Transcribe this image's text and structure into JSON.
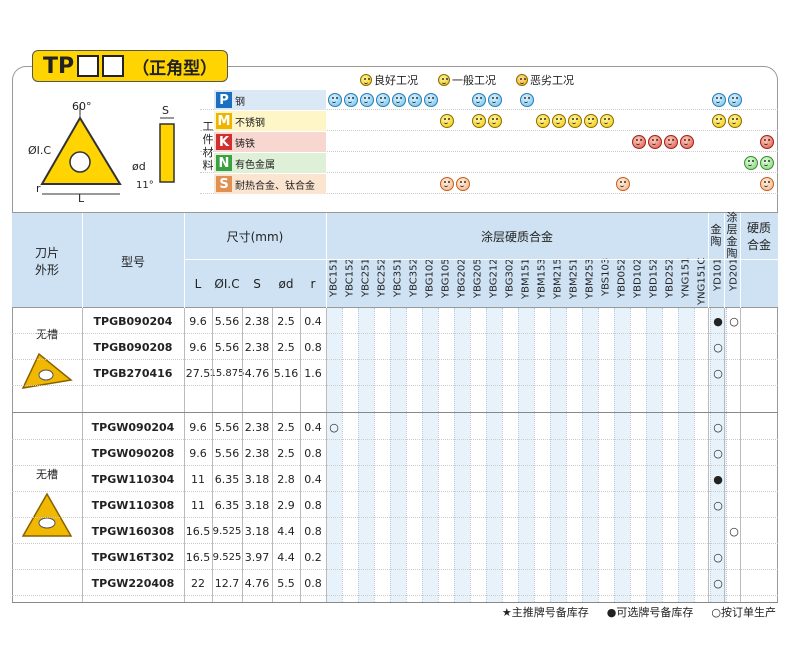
{
  "title": {
    "main": "TP",
    "sub": "（正角型）"
  },
  "legend_top": [
    {
      "icon": "good-face-icon",
      "label": "良好工况"
    },
    {
      "icon": "normal-face-icon",
      "label": "一般工况"
    },
    {
      "icon": "bad-face-icon",
      "label": "恶劣工况"
    }
  ],
  "diagram": {
    "angle": "60°",
    "ic": "ØI.C",
    "r": "r",
    "L": "L",
    "S": "S",
    "d": "ød",
    "eleven": "11°"
  },
  "work_material_label": "工件材料",
  "materials": [
    {
      "letter": "P",
      "name": "钢",
      "color": "#1a6fc0",
      "bg": "#dbe9f7",
      "faces": [
        0,
        1,
        2,
        3,
        4,
        5,
        6,
        9,
        10,
        12,
        24,
        25
      ],
      "type": "blue"
    },
    {
      "letter": "M",
      "name": "不锈钢",
      "color": "#f0b400",
      "bg": "#fff6c8",
      "faces": [
        7,
        9,
        10,
        13,
        14,
        15,
        16,
        17,
        24,
        25
      ],
      "type": "good"
    },
    {
      "letter": "K",
      "name": "铸铁",
      "color": "#d03030",
      "bg": "#f7d7d0",
      "faces": [
        19,
        20,
        21,
        22,
        27
      ],
      "type": "red"
    },
    {
      "letter": "N",
      "name": "有色金属",
      "color": "#3aa040",
      "bg": "#dff0d8",
      "faces": [
        26,
        27
      ],
      "type": "green"
    },
    {
      "letter": "S",
      "name": "耐热合金、钛合金",
      "color": "#e09050",
      "bg": "#fbe4d0",
      "faces": [
        7,
        8,
        18,
        27
      ],
      "type": "orange"
    }
  ],
  "headers": {
    "shape": "刀片外形",
    "model": "型号",
    "size": "尺寸(mm)",
    "size_cols": [
      "L",
      "ØI.C",
      "S",
      "ød",
      "r"
    ],
    "coated": "涂层硬质合金",
    "cermet": "金陶",
    "coated_cermet": "涂层金陶",
    "carbide": "硬质合金"
  },
  "grades": [
    "YBC151",
    "YBC152",
    "YBC251",
    "YBC252",
    "YBC351",
    "YBC352",
    "YBG102",
    "YBG105",
    "YBG202",
    "YBG205",
    "YBG212",
    "YBG302",
    "YBM151",
    "YBM153",
    "YBM215",
    "YBM251",
    "YBM253",
    "YBS103",
    "YBD052",
    "YBD102",
    "YBD152",
    "YBD252",
    "YNG151",
    "YNG151C",
    "YD101",
    "YD201"
  ],
  "group1": {
    "shape_label": "无槽",
    "rows": [
      {
        "model": "TPGB090204",
        "L": "9.6",
        "IC": "5.56",
        "S": "2.38",
        "d": "2.5",
        "r": "0.4",
        "marks": {
          "24": "●",
          "25": "○"
        }
      },
      {
        "model": "TPGB090208",
        "L": "9.6",
        "IC": "5.56",
        "S": "2.38",
        "d": "2.5",
        "r": "0.8",
        "marks": {
          "24": "○"
        }
      },
      {
        "model": "TPGB270416",
        "L": "27.5",
        "IC": "15.875",
        "S": "4.76",
        "d": "5.16",
        "r": "1.6",
        "marks": {
          "24": "○"
        }
      }
    ]
  },
  "group2": {
    "shape_label": "无槽",
    "rows": [
      {
        "model": "TPGW090204",
        "L": "9.6",
        "IC": "5.56",
        "S": "2.38",
        "d": "2.5",
        "r": "0.4",
        "marks": {
          "0": "○",
          "24": "○"
        }
      },
      {
        "model": "TPGW090208",
        "L": "9.6",
        "IC": "5.56",
        "S": "2.38",
        "d": "2.5",
        "r": "0.8",
        "marks": {
          "24": "○"
        }
      },
      {
        "model": "TPGW110304",
        "L": "11",
        "IC": "6.35",
        "S": "3.18",
        "d": "2.8",
        "r": "0.4",
        "marks": {
          "24": "●"
        }
      },
      {
        "model": "TPGW110308",
        "L": "11",
        "IC": "6.35",
        "S": "3.18",
        "d": "2.9",
        "r": "0.8",
        "marks": {
          "24": "○"
        }
      },
      {
        "model": "TPGW160308",
        "L": "16.5",
        "IC": "9.525",
        "S": "3.18",
        "d": "4.4",
        "r": "0.8",
        "marks": {
          "25": "○"
        }
      },
      {
        "model": "TPGW16T302",
        "L": "16.5",
        "IC": "9.525",
        "S": "3.97",
        "d": "4.4",
        "r": "0.2",
        "marks": {
          "24": "○"
        }
      },
      {
        "model": "TPGW220408",
        "L": "22",
        "IC": "12.7",
        "S": "4.76",
        "d": "5.5",
        "r": "0.8",
        "marks": {
          "24": "○"
        }
      }
    ]
  },
  "legend_bottom": [
    "★主推牌号备库存",
    "●可选牌号备库存",
    "○按订单生产"
  ]
}
